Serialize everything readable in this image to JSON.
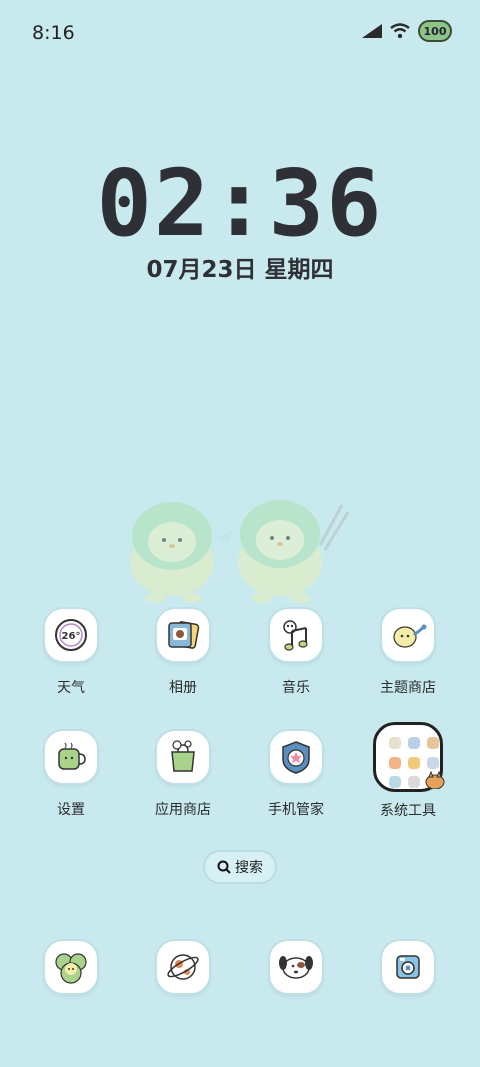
{
  "status_bar": {
    "time": "8:16",
    "battery": "100"
  },
  "lockclock": {
    "time": "02:36",
    "date": "07月23日 星期四"
  },
  "apps_row1": [
    {
      "label": "天气",
      "icon": "weather-icon",
      "badge": "26°"
    },
    {
      "label": "相册",
      "icon": "gallery-icon"
    },
    {
      "label": "音乐",
      "icon": "music-icon"
    },
    {
      "label": "主题商店",
      "icon": "theme-store-icon"
    }
  ],
  "apps_row2": [
    {
      "label": "设置",
      "icon": "settings-icon"
    },
    {
      "label": "应用商店",
      "icon": "app-store-icon"
    },
    {
      "label": "手机管家",
      "icon": "phone-manager-icon"
    },
    {
      "label": "系统工具",
      "icon": "system-tools-folder-icon"
    }
  ],
  "search": {
    "label": "搜索"
  },
  "dock": [
    {
      "icon": "phone-icon"
    },
    {
      "icon": "browser-icon"
    },
    {
      "icon": "messages-icon"
    },
    {
      "icon": "camera-icon"
    }
  ],
  "colors": {
    "background": "#c8eaef",
    "icon_bg": "#ffffff",
    "text": "#2b2b2b"
  }
}
